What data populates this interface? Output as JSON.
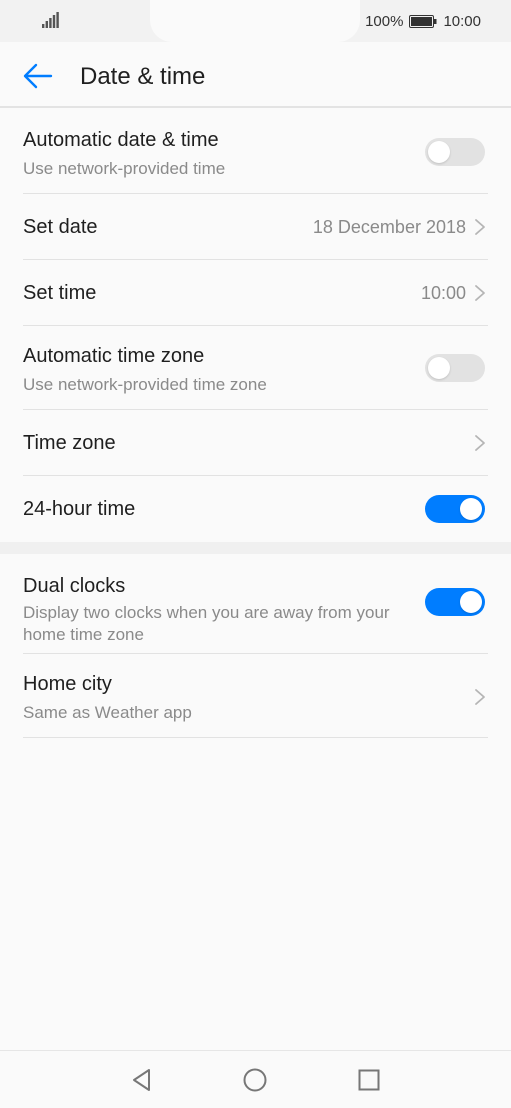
{
  "status_bar": {
    "battery_text": "100%",
    "time": "10:00",
    "icons": [
      "signal-icon",
      "battery-icon"
    ]
  },
  "app_bar": {
    "title": "Date & time",
    "back_icon": "arrow-left-icon"
  },
  "settings": {
    "automatic_date_time": {
      "title": "Automatic date & time",
      "subtitle": "Use network-provided time",
      "enabled": false
    },
    "set_date": {
      "title": "Set date",
      "value": "18 December 2018"
    },
    "set_time": {
      "title": "Set time",
      "value": "10:00"
    },
    "automatic_time_zone": {
      "title": "Automatic time zone",
      "subtitle": "Use network-provided time zone",
      "enabled": false
    },
    "time_zone": {
      "title": "Time zone"
    },
    "hour_24": {
      "title": "24-hour time",
      "enabled": true
    },
    "dual_clocks": {
      "title": "Dual clocks",
      "subtitle": "Display two clocks when you are away from your home time zone",
      "enabled": true
    },
    "home_city": {
      "title": "Home city",
      "subtitle": "Same as Weather app"
    }
  },
  "nav_bar": {
    "icons": [
      "back-triangle-icon",
      "home-circle-icon",
      "recents-square-icon"
    ]
  },
  "colors": {
    "accent": "#007dff",
    "toggle_off": "#e2e2e2",
    "secondary_text": "#8a8a8a",
    "primary_text": "#1f1f1f"
  }
}
